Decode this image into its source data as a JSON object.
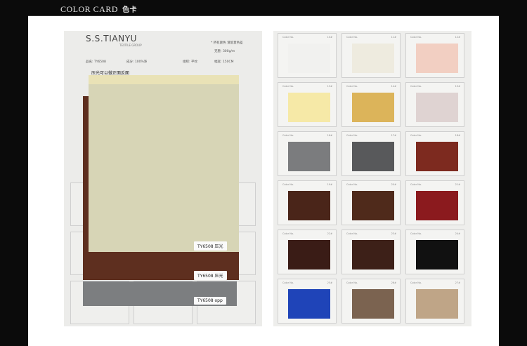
{
  "header": {
    "title": "COLOR CARD",
    "title_cn": "色卡"
  },
  "left_card": {
    "brand": "S.S.TIANYU",
    "brand_sub": "TEXTILE GROUP",
    "note_top": "* 所有颜色 请留意色差",
    "spec_lines": [
      "品名: TY6508",
      "成分: 100%涤",
      "幅宽: 150CM",
      "克重: 300g/m",
      "组织: 平纹"
    ],
    "header_note": "压光可以做正面反面",
    "tags": [
      "TY6508 压光",
      "TY6508 压光",
      "TY6508 opp"
    ],
    "colors": {
      "cream": "#d7d5b6",
      "brown": "#5e2f1f",
      "grey": "#7c7e80"
    }
  },
  "right_card": {
    "cell_label": "Color No.",
    "cells": [
      {
        "num": "10#",
        "color": "#f1f1ef"
      },
      {
        "num": "11#",
        "color": "#eeebdf"
      },
      {
        "num": "12#",
        "color": "#f2cfc2"
      },
      {
        "num": "13#",
        "color": "#f6e9a7"
      },
      {
        "num": "14#",
        "color": "#dcb45a"
      },
      {
        "num": "15#",
        "color": "#dfd3d2"
      },
      {
        "num": "16#",
        "color": "#7b7c7e"
      },
      {
        "num": "17#",
        "color": "#58595b"
      },
      {
        "num": "18#",
        "color": "#7d2a1f"
      },
      {
        "num": "19#",
        "color": "#4a2519"
      },
      {
        "num": "20#",
        "color": "#4f2a1b"
      },
      {
        "num": "21#",
        "color": "#8b1a1e"
      },
      {
        "num": "22#",
        "color": "#3a1c16"
      },
      {
        "num": "23#",
        "color": "#3d2018"
      },
      {
        "num": "24#",
        "color": "#111111"
      },
      {
        "num": "25#",
        "color": "#1f44b8"
      },
      {
        "num": "26#",
        "color": "#7b6350"
      },
      {
        "num": "27#",
        "color": "#bfa587"
      }
    ]
  }
}
